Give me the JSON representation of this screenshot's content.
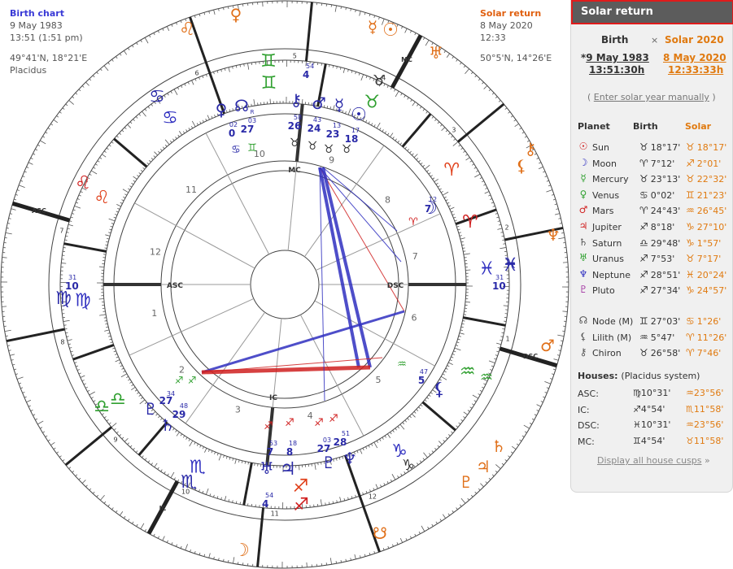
{
  "birth_info": {
    "title": "Birth chart",
    "date": "9 May 1983",
    "time": "13:51 (1:51 pm)",
    "coords": "49°41'N,  18°21'E",
    "house_system": "Placidus"
  },
  "solar_info": {
    "title": "Solar return",
    "date": "8 May 2020",
    "time": "12:33",
    "coords": "50°5'N,    14°26'E"
  },
  "panel": {
    "title": "Solar return",
    "birth_header": "Birth",
    "times_sign": "×",
    "solar_header": "Solar 2020",
    "birth_star": "*",
    "birth_date": "9 May 1983",
    "birth_time": "13:51:30h",
    "solar_date": "8 May 2020",
    "solar_time": "12:33:33h",
    "manual_open": "( ",
    "manual_link": "Enter solar year manually",
    "manual_close": " )",
    "col_planet": "Planet",
    "col_birth": "Birth",
    "col_solar": "Solar",
    "houses_title": "Houses:",
    "houses_system": "(Placidus system)",
    "display_all": "Display all house cusps",
    "display_arrow": " »"
  },
  "planets": [
    {
      "name": "Sun",
      "icon": "☉",
      "color": "#d02020",
      "birth_sign": "♉",
      "birth_pos": "18°17'",
      "solar_sign": "♉",
      "solar_pos": "18°17'"
    },
    {
      "name": "Moon",
      "icon": "☽",
      "color": "#3030c0",
      "birth_sign": "♈",
      "birth_pos": "7°12'",
      "solar_sign": "♐",
      "solar_pos": "2°01'"
    },
    {
      "name": "Mercury",
      "icon": "☿",
      "color": "#30a030",
      "birth_sign": "♉",
      "birth_pos": "23°13'",
      "solar_sign": "♉",
      "solar_pos": "22°32'"
    },
    {
      "name": "Venus",
      "icon": "♀",
      "color": "#30a030",
      "birth_sign": "♋",
      "birth_pos": "0°02'",
      "solar_sign": "♊",
      "solar_pos": "21°23'"
    },
    {
      "name": "Mars",
      "icon": "♂",
      "color": "#d02020",
      "birth_sign": "♈",
      "birth_pos": "24°43'",
      "solar_sign": "♒",
      "solar_pos": "26°45'"
    },
    {
      "name": "Jupiter",
      "icon": "♃",
      "color": "#d02020",
      "birth_sign": "♐",
      "birth_pos": "8°18'",
      "solar_sign": "♑",
      "solar_pos": "27°10'"
    },
    {
      "name": "Saturn",
      "icon": "♄",
      "color": "#555555",
      "birth_sign": "♎",
      "birth_pos": "29°48'",
      "solar_sign": "♑",
      "solar_pos": "1°57'"
    },
    {
      "name": "Uranus",
      "icon": "♅",
      "color": "#30a030",
      "birth_sign": "♐",
      "birth_pos": "7°53'",
      "solar_sign": "♉",
      "solar_pos": "7°17'"
    },
    {
      "name": "Neptune",
      "icon": "♆",
      "color": "#3030c0",
      "birth_sign": "♐",
      "birth_pos": "28°51'",
      "solar_sign": "♓",
      "solar_pos": "20°24'"
    },
    {
      "name": "Pluto",
      "icon": "♇",
      "color": "#a030a0",
      "birth_sign": "♐",
      "birth_pos": "27°34'",
      "solar_sign": "♑",
      "solar_pos": "24°57'"
    }
  ],
  "points": [
    {
      "name": "Node (M)",
      "icon": "☊",
      "color": "#555555",
      "birth_sign": "♊",
      "birth_pos": "27°03'",
      "solar_sign": "♋",
      "solar_pos": "1°26'"
    },
    {
      "name": "Lilith (M)",
      "icon": "⚸",
      "color": "#555555",
      "birth_sign": "♒",
      "birth_pos": "5°47'",
      "solar_sign": "♈",
      "solar_pos": "11°26'"
    },
    {
      "name": "Chiron",
      "icon": "⚷",
      "color": "#555555",
      "birth_sign": "♉",
      "birth_pos": "26°58'",
      "solar_sign": "♈",
      "solar_pos": "7°46'"
    }
  ],
  "houses": [
    {
      "name": "ASC:",
      "birth_sign": "♍",
      "birth_pos": "10°31'",
      "solar_sign": "♒",
      "solar_pos": "23°56'"
    },
    {
      "name": "IC:",
      "birth_sign": "♐",
      "birth_pos": "4°54'",
      "solar_sign": "♏",
      "solar_pos": "11°58'"
    },
    {
      "name": "DSC:",
      "birth_sign": "♓",
      "birth_pos": "10°31'",
      "solar_sign": "♒",
      "solar_pos": "23°56'"
    },
    {
      "name": "MC:",
      "birth_sign": "♊",
      "birth_pos": "4°54'",
      "solar_sign": "♉",
      "solar_pos": "11°58'"
    }
  ],
  "wheel": {
    "axis_labels": {
      "asc": "ASC",
      "dsc": "DSC",
      "mc": "MC",
      "ic": "IC"
    },
    "inner_house_numbers": [
      "1",
      "2",
      "3",
      "4",
      "5",
      "6",
      "7",
      "8",
      "9",
      "10",
      "11",
      "12"
    ],
    "outer_house_numbers": [
      "1",
      "2",
      "3",
      "4",
      "5",
      "6",
      "7",
      "8",
      "9",
      "10",
      "11",
      "12"
    ],
    "outer_axis_labels": {
      "asc": "ASC",
      "dsc": "DSC",
      "mc": "MC",
      "ic": "IC"
    },
    "asc_degree_small": "31",
    "asc_degree": "10",
    "dsc_degree_small": "31",
    "dsc_degree": "10",
    "mc_degree_small": "54",
    "mc_degree": "4",
    "ic_degree_small": "54",
    "ic_degree": "4",
    "zodiac": [
      "♈",
      "♉",
      "♊",
      "♋",
      "♌",
      "♍",
      "♎",
      "♏",
      "♐",
      "♑",
      "♒",
      "♓"
    ],
    "cluster_top": [
      {
        "glyph": "♀",
        "color": "#3030c0",
        "deg": "27",
        "min": "03"
      },
      {
        "glyph": "☊",
        "color": "#3030c0",
        "deg": "02",
        "min": "02"
      }
    ],
    "cluster_top_labels": {
      "venus_min": "02",
      "venus_deg": "0",
      "node_min": "03",
      "node_deg": "27",
      "node_r": "R"
    },
    "cluster_mc": {
      "chiron_min": "58",
      "chiron_deg": "26",
      "mars_min": "43",
      "mars_deg": "24",
      "merc_min": "13",
      "merc_deg": "23",
      "sun_min": "17",
      "sun_deg": "18"
    },
    "cluster_left": {
      "pluto_min": "34",
      "pluto_deg": "27",
      "saturn_min": "48",
      "saturn_deg": "29"
    },
    "cluster_bottom": {
      "uranus_min": "53",
      "uranus_deg": "7",
      "jup_min": "18",
      "jup_deg": "8",
      "pluto_min": "03",
      "pluto_deg": "27",
      "nep_min": "51",
      "nep_deg": "28"
    },
    "cluster_right": {
      "moon_min": "12",
      "moon_deg": "7",
      "lilith_min": "47",
      "lilith_deg": "5"
    }
  }
}
